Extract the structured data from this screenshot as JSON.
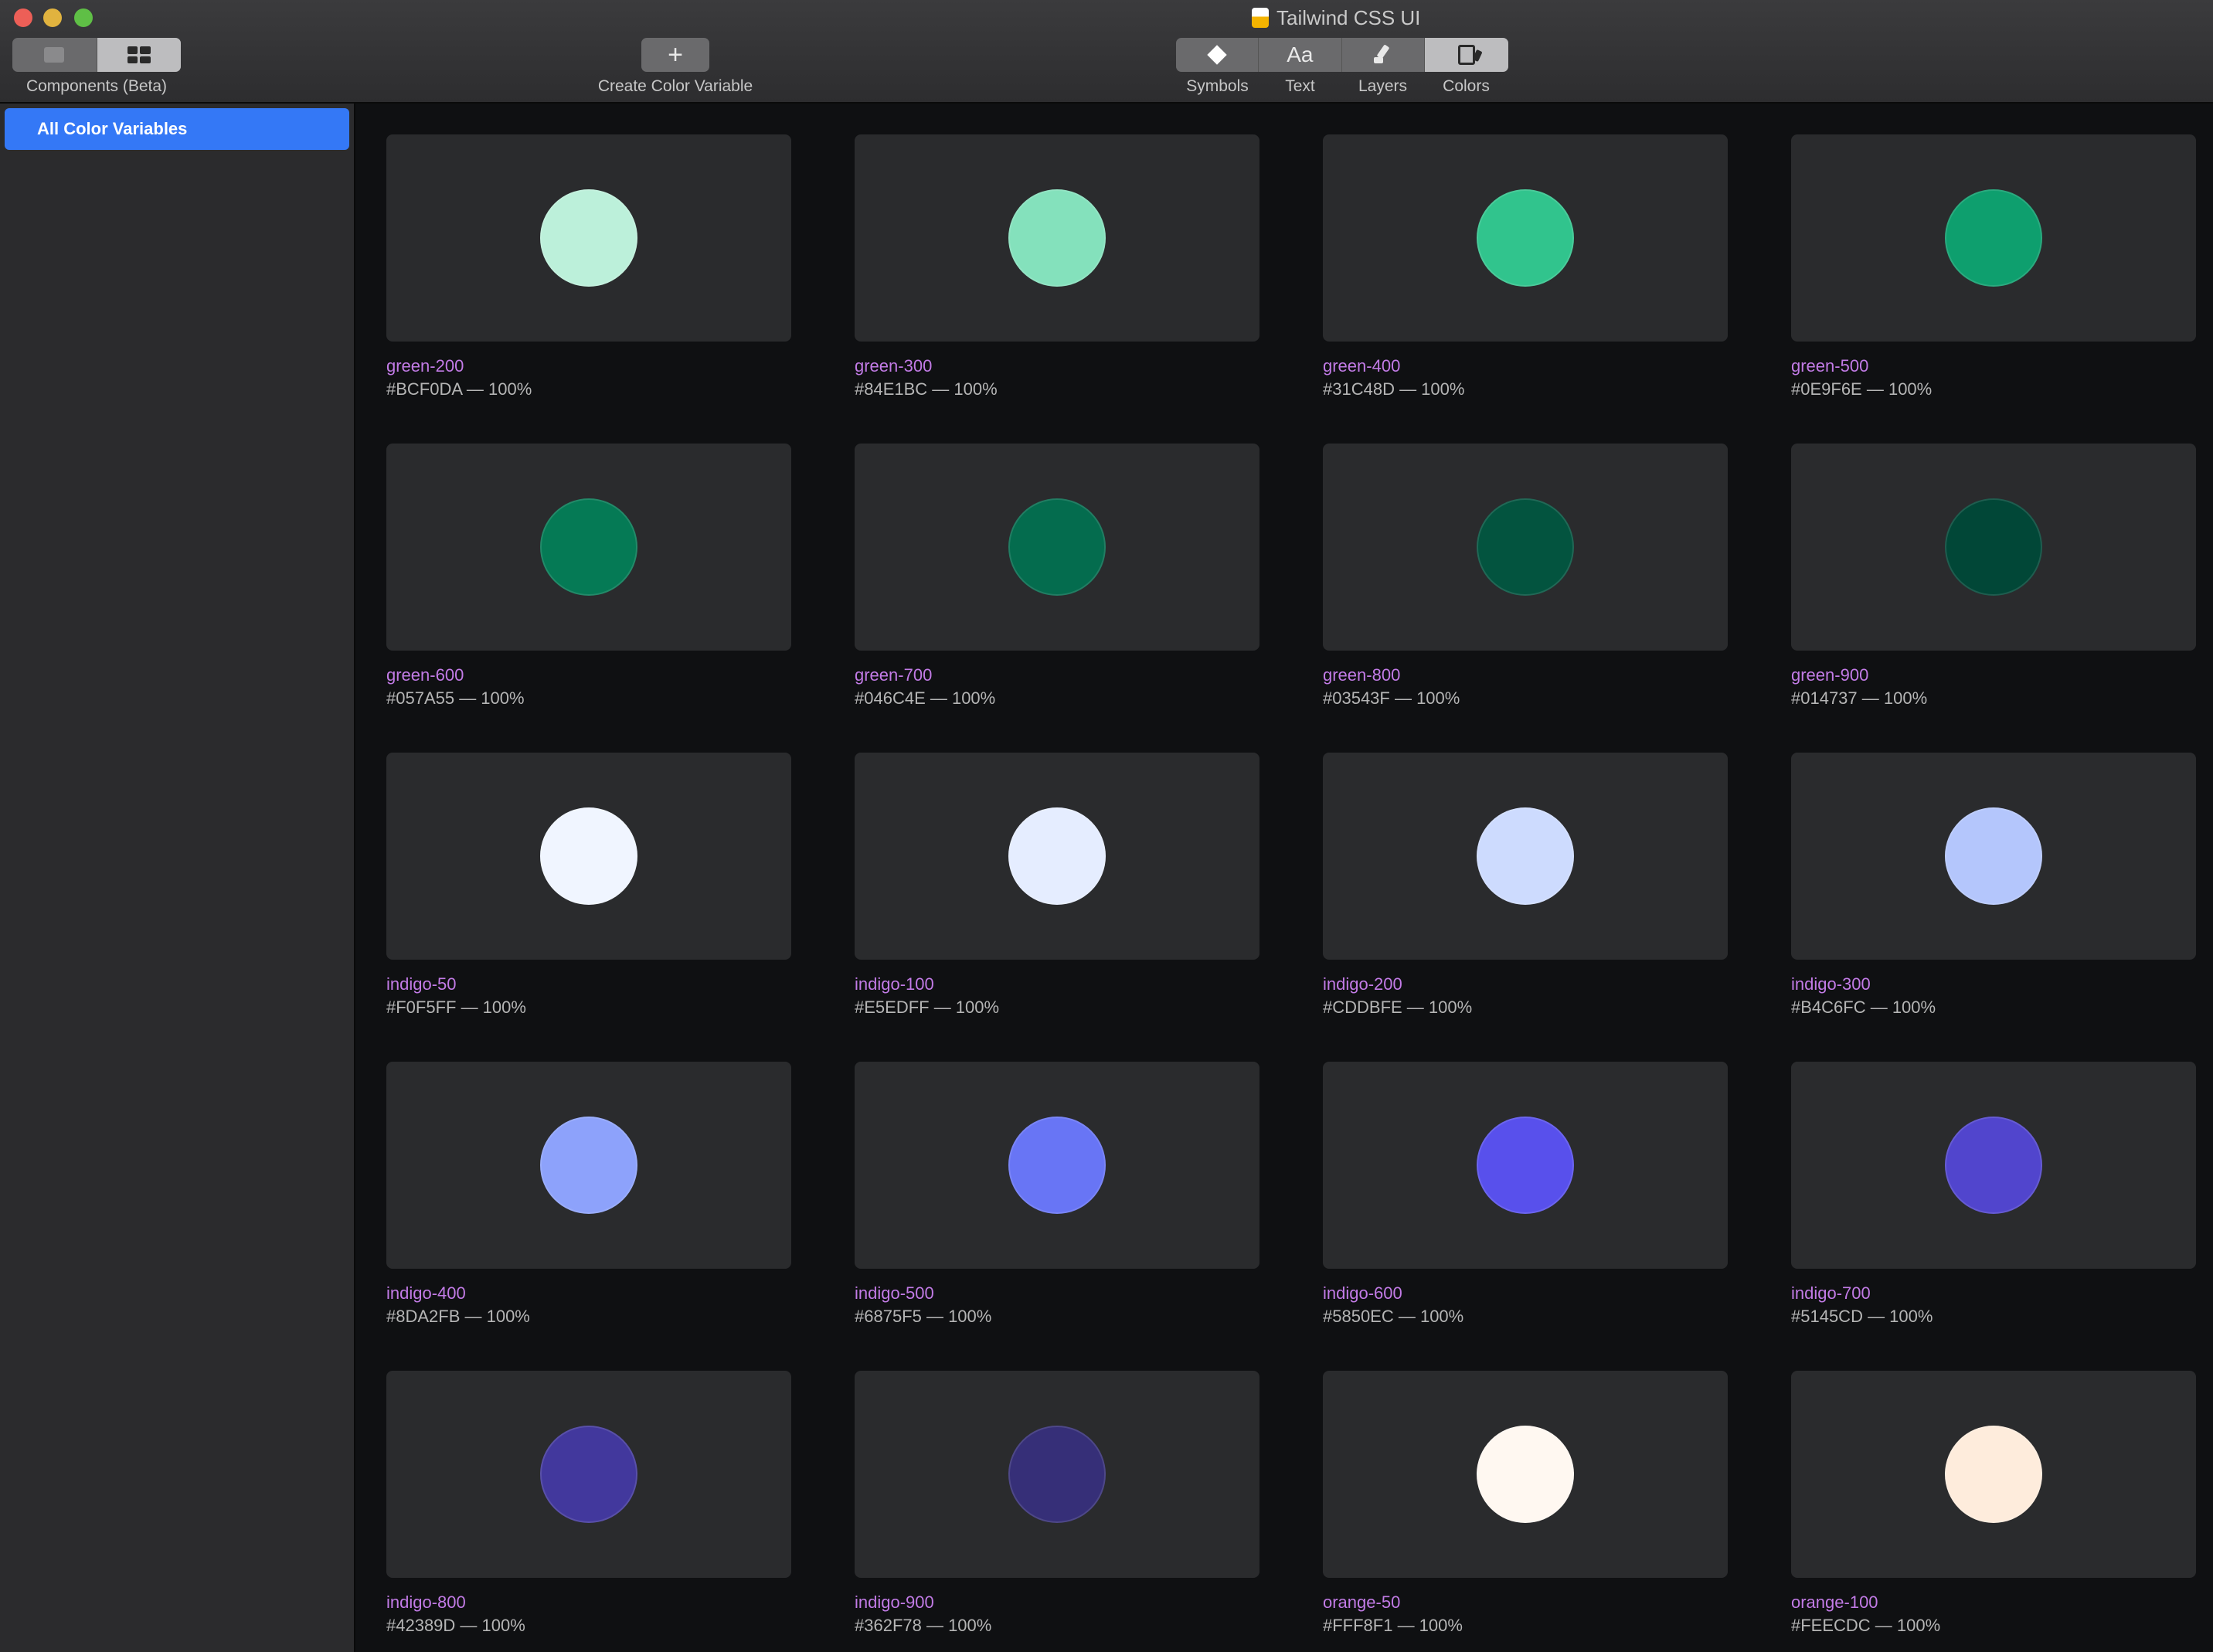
{
  "window": {
    "title": "Tailwind CSS UI"
  },
  "toolbar": {
    "components_label": "Components (Beta)",
    "create_label": "Create Color Variable",
    "create_glyph": "+",
    "views": [
      {
        "label": "Symbols",
        "glyph": ""
      },
      {
        "label": "Text",
        "glyph": "Aa"
      },
      {
        "label": "Layers",
        "glyph": ""
      },
      {
        "label": "Colors",
        "glyph": ""
      }
    ]
  },
  "sidebar": {
    "selected": "All Color Variables"
  },
  "colors": [
    {
      "name": "green-200",
      "hex": "#BCF0DA — 100%",
      "color": "#BCF0DA"
    },
    {
      "name": "green-300",
      "hex": "#84E1BC — 100%",
      "color": "#84E1BC"
    },
    {
      "name": "green-400",
      "hex": "#31C48D — 100%",
      "color": "#31C48D"
    },
    {
      "name": "green-500",
      "hex": "#0E9F6E — 100%",
      "color": "#0E9F6E"
    },
    {
      "name": "green-600",
      "hex": "#057A55 — 100%",
      "color": "#057A55"
    },
    {
      "name": "green-700",
      "hex": "#046C4E — 100%",
      "color": "#046C4E"
    },
    {
      "name": "green-800",
      "hex": "#03543F — 100%",
      "color": "#03543F"
    },
    {
      "name": "green-900",
      "hex": "#014737 — 100%",
      "color": "#014737"
    },
    {
      "name": "indigo-50",
      "hex": "#F0F5FF — 100%",
      "color": "#F0F5FF"
    },
    {
      "name": "indigo-100",
      "hex": "#E5EDFF — 100%",
      "color": "#E5EDFF"
    },
    {
      "name": "indigo-200",
      "hex": "#CDDBFE — 100%",
      "color": "#CDDBFE"
    },
    {
      "name": "indigo-300",
      "hex": "#B4C6FC — 100%",
      "color": "#B4C6FC"
    },
    {
      "name": "indigo-400",
      "hex": "#8DA2FB — 100%",
      "color": "#8DA2FB"
    },
    {
      "name": "indigo-500",
      "hex": "#6875F5 — 100%",
      "color": "#6875F5"
    },
    {
      "name": "indigo-600",
      "hex": "#5850EC — 100%",
      "color": "#5850EC"
    },
    {
      "name": "indigo-700",
      "hex": "#5145CD — 100%",
      "color": "#5145CD"
    },
    {
      "name": "indigo-800",
      "hex": "#42389D — 100%",
      "color": "#42389D"
    },
    {
      "name": "indigo-900",
      "hex": "#362F78 — 100%",
      "color": "#362F78"
    },
    {
      "name": "orange-50",
      "hex": "#FFF8F1 — 100%",
      "color": "#FFF8F1"
    },
    {
      "name": "orange-100",
      "hex": "#FEECDC — 100%",
      "color": "#FEECDC"
    }
  ]
}
